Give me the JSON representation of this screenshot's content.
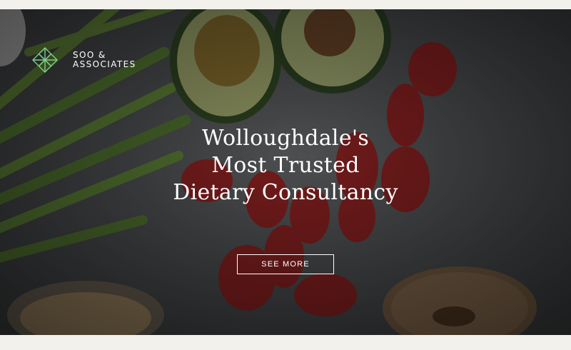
{
  "brand": {
    "line1": "SOO &",
    "line2": "ASSOCIATES",
    "logo_icon": "lattice-logo-icon"
  },
  "hero": {
    "headline_lines": [
      "Wolloughdale's",
      "Most Trusted",
      "Dietary Consultancy"
    ],
    "cta_label": "SEE MORE"
  },
  "colors": {
    "page_background": "#f2f1ec",
    "text": "#ffffff",
    "logo_mark": "#7ccf8a"
  }
}
